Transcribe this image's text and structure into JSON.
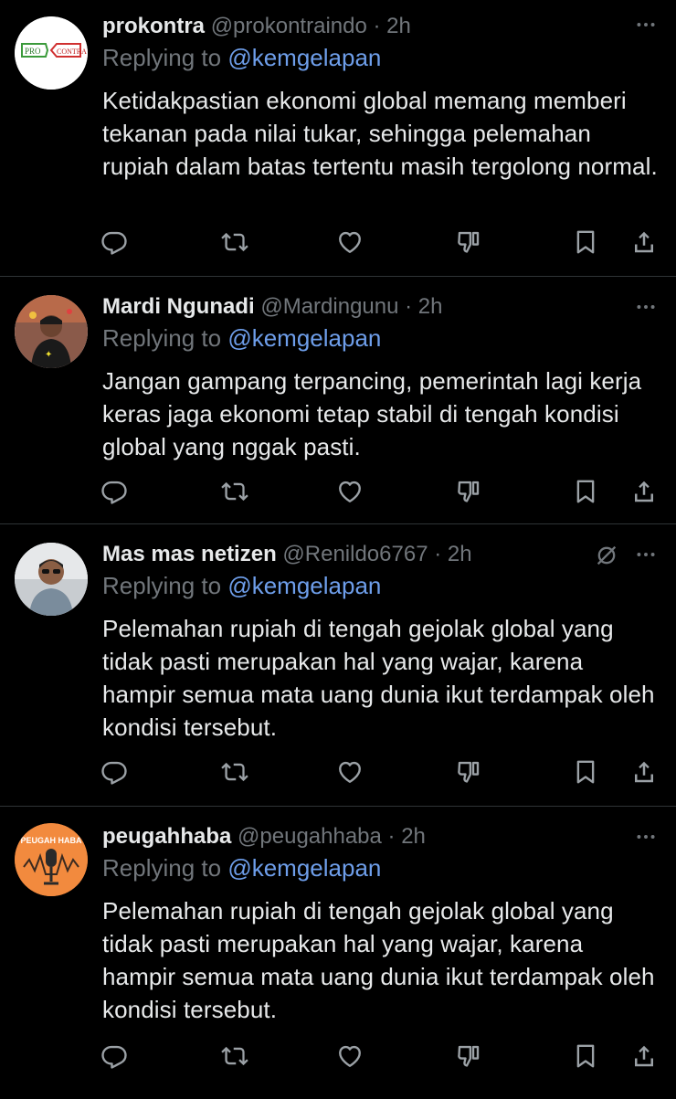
{
  "tweets": [
    {
      "name": "prokontra",
      "handle": "@prokontraindo",
      "time": "2h",
      "replying_prefix": "Replying to",
      "replying_to": "@kemgelapan",
      "text": "Ketidakpastian ekonomi global memang memberi tekanan pada nilai tukar, sehingga pelemahan rupiah dalam batas tertentu masih tergolong normal.",
      "avatar_text": [
        "PRO",
        "CONTRA"
      ]
    },
    {
      "name": "Mardi Ngunadi",
      "handle": "@Mardingunu",
      "time": "2h",
      "replying_prefix": "Replying to",
      "replying_to": "@kemgelapan",
      "text": "Jangan gampang terpancing, pemerintah lagi kerja keras jaga ekonomi tetap stabil di tengah kondisi global yang nggak pasti."
    },
    {
      "name": "Mas mas netizen",
      "handle": "@Renildo6767",
      "time": "2h",
      "replying_prefix": "Replying to",
      "replying_to": "@kemgelapan",
      "text": "Pelemahan rupiah di tengah gejolak global yang tidak pasti merupakan hal yang wajar, karena hampir semua mata uang dunia ikut terdampak oleh kondisi tersebut."
    },
    {
      "name": "peugahhaba",
      "handle": "@peugahhaba",
      "time": "2h",
      "replying_prefix": "Replying to",
      "replying_to": "@kemgelapan",
      "text": "Pelemahan rupiah di tengah gejolak global yang tidak pasti merupakan hal yang wajar, karena hampir semua mata uang dunia ikut terdampak oleh kondisi tersebut.",
      "avatar_text": [
        "PEUGAH HABA"
      ]
    }
  ],
  "icons": [
    "reply-icon",
    "retweet-icon",
    "like-icon",
    "downvote-icon",
    "bookmark-icon",
    "share-icon",
    "more-icon",
    "mute-icon"
  ],
  "colors": {
    "background": "#000000",
    "text": "#e7e9ea",
    "muted": "#71767b",
    "mention": "#6e9eea",
    "divider": "#2f3336"
  }
}
